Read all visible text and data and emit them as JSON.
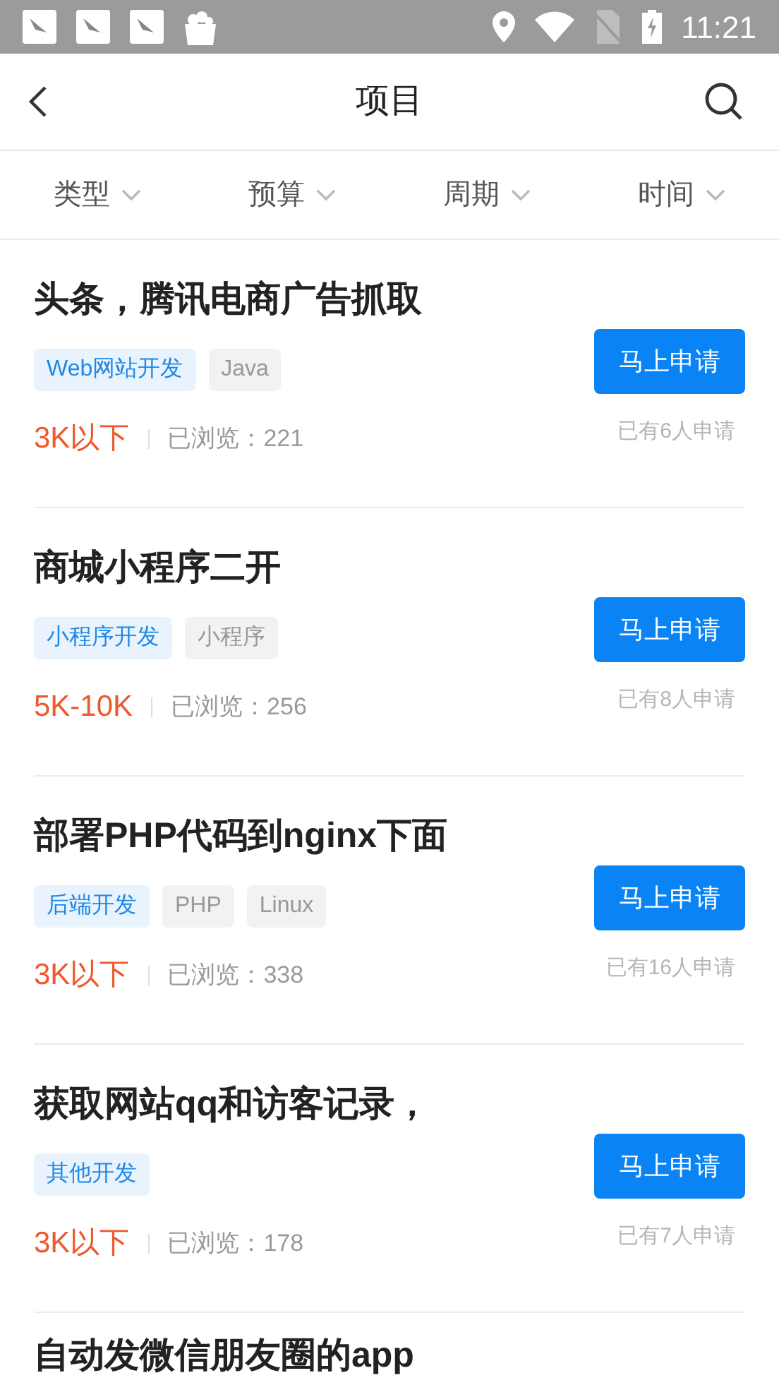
{
  "status_bar": {
    "time": "11:21"
  },
  "header": {
    "title": "项目"
  },
  "filters": [
    {
      "label": "类型"
    },
    {
      "label": "预算"
    },
    {
      "label": "周期"
    },
    {
      "label": "时间"
    }
  ],
  "projects": [
    {
      "title": "头条，腾讯电商广告抓取",
      "tags": [
        {
          "label": "Web网站开发",
          "kind": "category"
        },
        {
          "label": "Java",
          "kind": "skill"
        }
      ],
      "budget": "3K以下",
      "views": "已浏览：221",
      "button": "马上申请",
      "applicants": "已有6人申请"
    },
    {
      "title": "商城小程序二开",
      "tags": [
        {
          "label": "小程序开发",
          "kind": "category"
        },
        {
          "label": "小程序",
          "kind": "skill"
        }
      ],
      "budget": "5K-10K",
      "views": "已浏览：256",
      "button": "马上申请",
      "applicants": "已有8人申请"
    },
    {
      "title": "部署PHP代码到nginx下面",
      "tags": [
        {
          "label": "后端开发",
          "kind": "category"
        },
        {
          "label": "PHP",
          "kind": "skill"
        },
        {
          "label": "Linux",
          "kind": "skill"
        }
      ],
      "budget": "3K以下",
      "views": "已浏览：338",
      "button": "马上申请",
      "applicants": "已有16人申请"
    },
    {
      "title": "获取网站qq和访客记录，",
      "tags": [
        {
          "label": "其他开发",
          "kind": "category"
        }
      ],
      "budget": "3K以下",
      "views": "已浏览：178",
      "button": "马上申请",
      "applicants": "已有7人申请"
    },
    {
      "title": "自动发微信朋友圈的app"
    }
  ]
}
